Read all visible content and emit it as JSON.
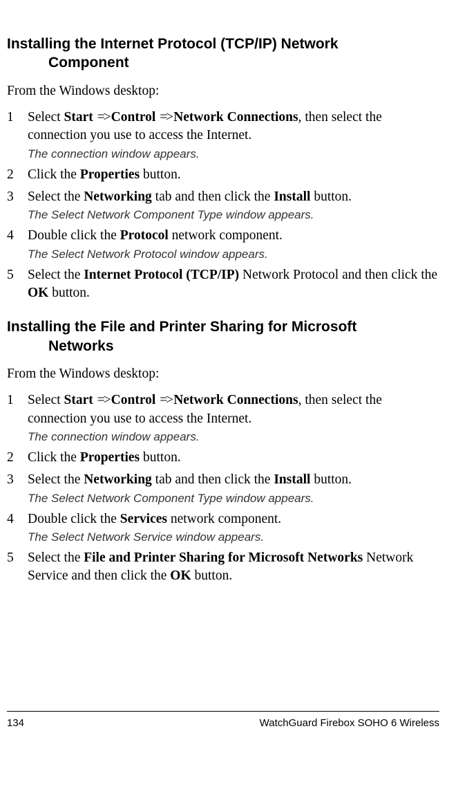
{
  "sections": [
    {
      "heading_line1": "Installing the Internet Protocol (TCP/IP) Network",
      "heading_line2": "Component",
      "intro": "From the Windows desktop:",
      "steps": [
        {
          "num": "1",
          "parts": [
            "Select ",
            "Start",
            " ",
            "=>",
            "Control",
            " ",
            "=>",
            "Network Connections",
            ", then select the connection you use to access the Internet."
          ],
          "bold": [
            1,
            4,
            7
          ],
          "arrow": [
            3,
            6
          ],
          "note": "The connection window appears."
        },
        {
          "num": "2",
          "parts": [
            "Click the ",
            "Properties",
            " button."
          ],
          "bold": [
            1
          ],
          "arrow": [],
          "note": null
        },
        {
          "num": "3",
          "parts": [
            "Select the ",
            "Networking",
            " tab and then click the ",
            "Install",
            " button."
          ],
          "bold": [
            1,
            3
          ],
          "arrow": [],
          "note": "The Select Network Component Type window appears."
        },
        {
          "num": "4",
          "parts": [
            "Double click the ",
            "Protocol",
            " network component."
          ],
          "bold": [
            1
          ],
          "arrow": [],
          "note": "The Select Network Protocol window appears."
        },
        {
          "num": "5",
          "parts": [
            "Select the ",
            "Internet Protocol (TCP/IP)",
            " Network Protocol and then click the ",
            "OK",
            " button."
          ],
          "bold": [
            1,
            3
          ],
          "arrow": [],
          "note": null
        }
      ]
    },
    {
      "heading_line1": "Installing the File and Printer Sharing for Microsoft",
      "heading_line2": "Networks",
      "intro": "From the Windows desktop:",
      "steps": [
        {
          "num": "1",
          "parts": [
            "Select ",
            "Start",
            " ",
            "=>",
            "Control",
            " ",
            "=>",
            "Network Connections",
            ", then select the connection you use to access the Internet."
          ],
          "bold": [
            1,
            4,
            7
          ],
          "arrow": [
            3,
            6
          ],
          "note": "The connection window appears."
        },
        {
          "num": "2",
          "parts": [
            "Click the ",
            "Properties",
            " button."
          ],
          "bold": [
            1
          ],
          "arrow": [],
          "note": null
        },
        {
          "num": "3",
          "parts": [
            "Select the ",
            "Networking",
            " tab and then click the ",
            "Install",
            " button."
          ],
          "bold": [
            1,
            3
          ],
          "arrow": [],
          "note": "The Select Network Component Type window appears."
        },
        {
          "num": "4",
          "parts": [
            "Double click the ",
            "Services",
            " network component."
          ],
          "bold": [
            1
          ],
          "arrow": [],
          "note": "The Select Network Service window appears."
        },
        {
          "num": "5",
          "parts": [
            "Select the ",
            "File and Printer Sharing for Microsoft Networks",
            " Network Service and then click the ",
            "OK",
            " button."
          ],
          "bold": [
            1,
            3
          ],
          "arrow": [],
          "note": null
        }
      ]
    }
  ],
  "footer": {
    "page_num": "134",
    "doc_title": "WatchGuard Firebox SOHO 6 Wireless"
  }
}
